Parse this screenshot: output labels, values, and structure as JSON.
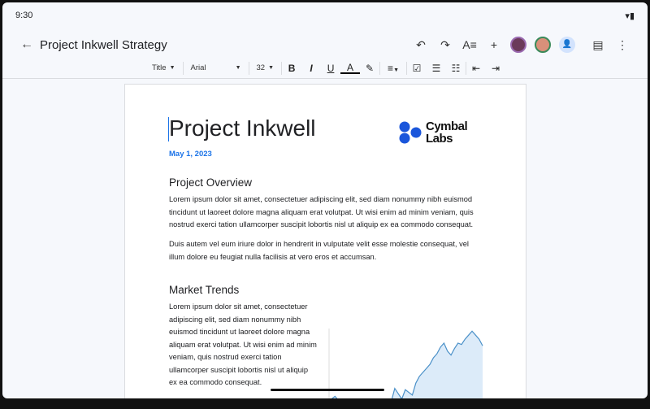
{
  "status": {
    "time": "9:30"
  },
  "appbar": {
    "title": "Project Inkwell Strategy"
  },
  "toolbar": {
    "style": "Title",
    "font": "Arial",
    "size": "32"
  },
  "document": {
    "title": "Project Inkwell",
    "date": "May 1, 2023",
    "logo": "Cymbal Labs",
    "section1": {
      "heading": "Project Overview",
      "p1": "Lorem ipsum dolor sit amet, consectetuer adipiscing elit, sed diam nonummy nibh euismod tincidunt ut laoreet dolore magna aliquam erat volutpat. Ut wisi enim ad minim veniam, quis nostrud exerci tation ullamcorper suscipit lobortis nisl ut aliquip ex ea commodo consequat.",
      "p2": "Duis autem vel eum iriure dolor in hendrerit in vulputate velit esse molestie consequat, vel illum dolore eu feugiat nulla facilisis at vero eros et accumsan."
    },
    "section2": {
      "heading": "Market Trends",
      "p1": "Lorem ipsum dolor sit amet, consectetuer adipiscing elit, sed diam nonummy nibh euismod tincidunt ut laoreet dolore magna aliquam erat volutpat. Ut wisi enim ad minim veniam, quis nostrud exerci tation ullamcorper suscipit lobortis nisl ut aliquip ex ea commodo consequat."
    }
  },
  "embedded_chart": {
    "type": "area",
    "values": [
      2,
      4,
      1,
      0,
      0,
      0,
      0,
      0,
      0,
      0,
      0,
      0,
      0,
      0,
      0,
      0,
      0,
      0,
      10,
      6,
      2,
      9,
      7,
      5,
      14,
      19,
      22,
      25,
      28,
      33,
      36,
      41,
      44,
      38,
      35,
      40,
      44,
      43,
      47,
      50,
      53,
      50,
      47,
      42
    ],
    "color": "#4a90c8"
  }
}
